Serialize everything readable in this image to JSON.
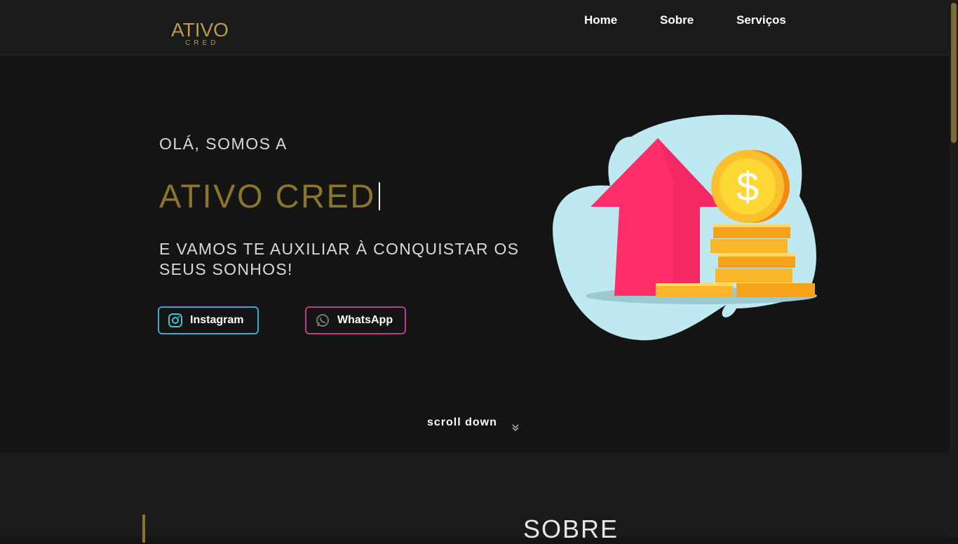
{
  "brand": {
    "logo_main": "ATIVO",
    "logo_sub": "CRED"
  },
  "nav": {
    "items": [
      "Home",
      "Sobre",
      "Serviços"
    ]
  },
  "hero": {
    "greeting": "OLÁ, SOMOS A",
    "title": "ATIVO CRED",
    "subtitle": "E VAMOS TE AUXILIAR À CONQUISTAR OS SEUS SONHOS!",
    "buttons": {
      "instagram": "Instagram",
      "whatsapp": "WhatsApp"
    },
    "illustration_icons": [
      "arrow-up-icon",
      "dollar-coin-icon",
      "coin-stack-icon"
    ]
  },
  "scroll": {
    "label": "scroll down"
  },
  "about": {
    "title": "SOBRE"
  },
  "colors": {
    "accent_gold": "#8c7428",
    "instagram_border": "#3ba7d4",
    "whatsapp_border": "#b4408a",
    "background": "#141414"
  }
}
